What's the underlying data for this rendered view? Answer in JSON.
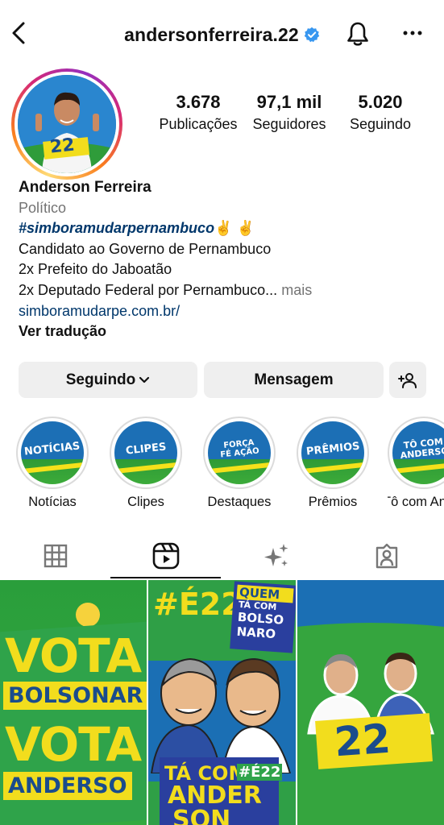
{
  "header": {
    "username": "andersonferreira.22",
    "back_icon": "chevron-left-icon",
    "verified_icon": "verified-badge-icon",
    "bell_icon": "bell-icon",
    "more_icon": "more-horizontal-icon"
  },
  "stats": {
    "posts": {
      "value": "3.678",
      "label": "Publicações"
    },
    "followers": {
      "value": "97,1 mil",
      "label": "Seguidores"
    },
    "following": {
      "value": "5.020",
      "label": "Seguindo"
    }
  },
  "bio": {
    "name": "Anderson Ferreira",
    "category": "Político",
    "hashtag": "#simboramudarpernambuco",
    "hashtag_emoji": "✌️ ✌️",
    "line1": "Candidato ao Governo de Pernambuco",
    "line2": "2x Prefeito do Jaboatão",
    "line3": "2x Deputado Federal por Pernambuco...",
    "more": "mais",
    "link": "simboramudarpe.com.br/",
    "translate": "Ver tradução"
  },
  "actions": {
    "following": "Seguindo",
    "message": "Mensagem",
    "add_user_icon": "add-user-icon"
  },
  "highlights": [
    {
      "label": "Notícias",
      "cover": "NOTÍCIAS"
    },
    {
      "label": "Clipes",
      "cover": "CLIPES"
    },
    {
      "label": "Destaques",
      "cover": "FORÇA FÉ AÇÃO"
    },
    {
      "label": "Prêmios",
      "cover": "PRÊMIOS"
    },
    {
      "label": "Tô com An",
      "cover": "TÔ COM ANDERSON"
    }
  ],
  "avatar": {
    "number": "22"
  },
  "posts": {
    "post1": {
      "line1": "VOTA",
      "tag1": "BOLSONAR",
      "line2": "VOTA",
      "tag2": "ANDERSO"
    },
    "post2": {
      "top": "#É22",
      "side1": "QUEM",
      "side2": "TÁ COM",
      "side3": "BOLSO",
      "side4": "NARO",
      "bottom1": "TÁ COM",
      "bottom2": "#É22",
      "bottom3": "ANDER",
      "bottom4": "SON"
    },
    "post3": {
      "number": "22"
    }
  },
  "colors": {
    "link": "#00376b",
    "muted": "#737373",
    "button_bg": "#efefef",
    "verified": "#3897f0",
    "campaign_green": "#2f9f46",
    "campaign_yellow": "#f2dd1d",
    "campaign_blue": "#1b6fb4"
  }
}
